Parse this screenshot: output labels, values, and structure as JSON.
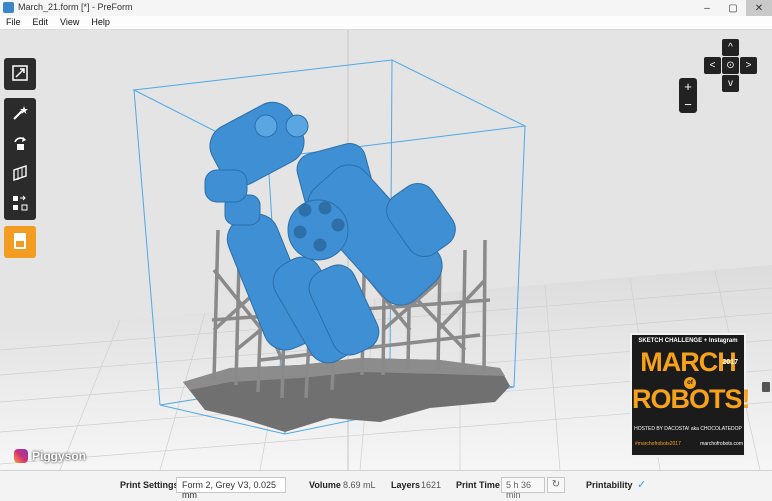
{
  "window": {
    "title": "March_21.form [*] - PreForm",
    "minimize": "–",
    "maximize": "▢",
    "close": "✕"
  },
  "menu": [
    "File",
    "Edit",
    "View",
    "Help"
  ],
  "toolbar": {
    "tools": [
      "fit-view-icon",
      "magic-wand-icon",
      "rotate-icon",
      "supports-icon",
      "layout-icon"
    ],
    "active_tool": "print-job-icon",
    "accent": "#f29c22"
  },
  "navigation": {
    "zoom_in": "+",
    "zoom_out": "−",
    "pan_up": "^",
    "pan_down": "v",
    "pan_left": "<",
    "pan_right": ">",
    "center": "⊙"
  },
  "status": {
    "print_settings_label": "Print Settings",
    "print_settings_value": "Form 2, Grey V3, 0.025 mm",
    "volume_label": "Volume",
    "volume_value": "8.69 mL",
    "layers_label": "Layers",
    "layers_value": "1621",
    "print_time_label": "Print Time",
    "print_time_value": "5 h 36 min",
    "printability_label": "Printability",
    "printability_icon": "check-icon",
    "printability_color": "#2aa8e0"
  },
  "model": {
    "body_color": "#3e8fd3",
    "support_color": "#8a8a8a"
  },
  "poster": {
    "top": "SKETCH CHALLENGE + Instagram",
    "line1": "MARCH",
    "of": "of",
    "year": "2017",
    "line2": "ROBOTS!",
    "host": "HOSTED BY DACOSTA! aka CHOCOLATEDOP",
    "hashtag": "#marchofrobots2017",
    "site": "marchofrobots.com"
  },
  "watermark": {
    "text": "Piggyson"
  }
}
